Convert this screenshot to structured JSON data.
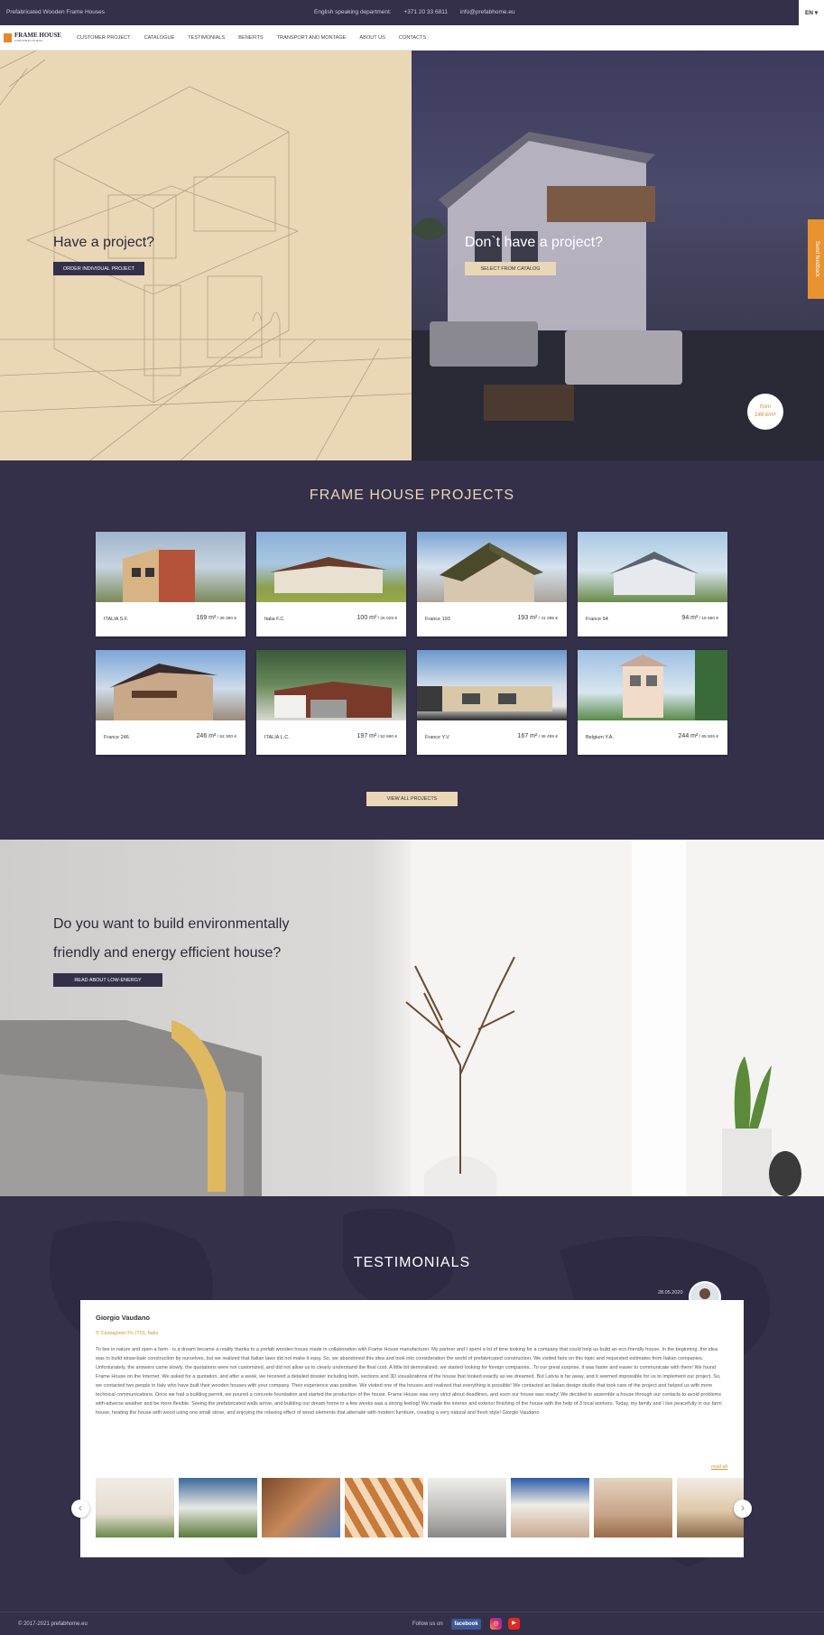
{
  "topbar": {
    "tagline": "Prefabricated Wooden Frame Houses",
    "dept": "English speaking department:",
    "phone": "+371 20 33 6811",
    "email": "info@prefabhome.eu",
    "lang": "EN ▾"
  },
  "logo": {
    "name": "FRAME HOUSE",
    "sub": "CONSTRUCTIONS"
  },
  "menu": [
    "CUSTOMER PROJECT",
    "CATALOGUE",
    "TESTIMONIALS",
    "BENEFITS",
    "TRANSPORT AND MONTAGE",
    "ABOUT US",
    "CONTACTS"
  ],
  "hero": {
    "left_title": "Have a project?",
    "left_button": "ORDER INDIVIDUAL PROJECT",
    "right_title": "Don`t have a project?",
    "right_button": "SELECT FROM CATALOG",
    "badge_line1": "from",
    "badge_line2": "148 €/m²",
    "feedback": "Send feedback"
  },
  "projects": {
    "title": "FRAME HOUSE PROJECTS",
    "items": [
      {
        "name": "ITALIA S.F.",
        "area": "169 m²",
        "price": " / 39 390 €"
      },
      {
        "name": "Italia F.C.",
        "area": "100 m²",
        "price": " / 26 025 €"
      },
      {
        "name": "France 193",
        "area": "193 m²",
        "price": " / 41 285 €"
      },
      {
        "name": "France 94",
        "area": "94 m²",
        "price": " / 18 660 €"
      },
      {
        "name": "France 246",
        "area": "246 m²",
        "price": " / 52 300 €"
      },
      {
        "name": "ITALIA L.C.",
        "area": "197 m²",
        "price": " / 52 690 €"
      },
      {
        "name": "France Y.V.",
        "area": "167 m²",
        "price": " / 38 495 €"
      },
      {
        "name": "Belgium Y.A.",
        "area": "244 m²",
        "price": " / 65 925 €"
      }
    ],
    "view_all": "VIEW ALL PROJECTS"
  },
  "eco": {
    "title": "Do you want to build environmentally friendly and energy efficient house?",
    "button": "READ ABOUT LOW-ENERGY"
  },
  "testimonials": {
    "title": "TESTIMONIALS",
    "date": "28.05.2020",
    "name": "Giorgio Vaudano",
    "location": "Castagneto Po (TO), Italia",
    "text": "To live in nature and open a farm - is a dream became a reality thanks to a prefab wooden house made in collaboration with Frame House manufacturer. My partner and I spent a lot of time looking for a company that could help us build an eco-friendly house. In the beginning, the idea was to build straw-bale construction by ourselves, but we realized that Italian laws did not make it easy. So, we abandoned this idea and took into consideration the world of prefabricated construction. We visited fairs on this topic and requested estimates from Italian companies. Unfortunately, the answers came slowly, the quotations were not customized, and did not allow us to clearly understand the final cost. A little bit demoralized, we started looking for foreign companies...To our great surprise, it was faster and easier to communicate with them! We found Frame House on the Internet. We asked for a quotation, and after a week, we received a detailed dossier including both, sections and 3D visualizations of the house that looked exactly as we dreamed. But Latvia is far away, and it seemed impossible for us to implement our project. So, we contacted two people in Italy who have built their wooden houses with your company. Their experience was positive. We visited one of the houses and realized that everything is possible! We contacted an Italian design studio that took care of the project and helped us with more technical communications. Once we had a building permit, we poured a concrete foundation and started the production of the house. Frame House was very strict about deadlines, and soon our house was ready! We decided to assemble a house through our contacts to avoid problems with adverse weather and be more flexible. Seeing the prefabricated walls arrive, and building our dream home in a few weeks was a strong feeling! We made the interior and exterior finishing of the house with the help of 3 local workers. Today, my family and I live peacefully in our farm house, heating the house with wood using one small stove, and enjoying the relaxing effect of wood elements that alternate with modern furniture, creating a very natural and fresh style! Giorgio Vaudano",
    "read_all": "read all",
    "prev": "‹",
    "next": "›"
  },
  "footer": {
    "copy": "© 2017-2021 prefabhome.eu",
    "follow": "Follow us on",
    "facebook": "facebook",
    "instagram": "◎",
    "youtube": "▶"
  },
  "colors": {
    "navy": "#34304a",
    "sand": "#ead7b6",
    "orange": "#e8932f"
  }
}
